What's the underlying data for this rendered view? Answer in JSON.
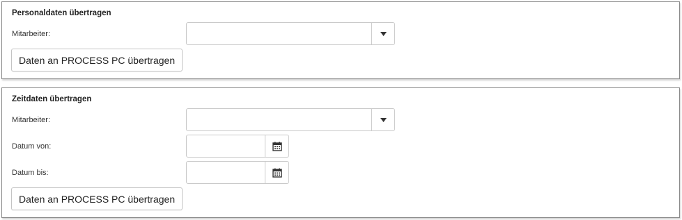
{
  "personaldaten": {
    "title": "Personaldaten übertragen",
    "mitarbeiter_label": "Mitarbeiter:",
    "mitarbeiter_value": "",
    "submit_label": "Daten an PROCESS PC übertragen"
  },
  "zeitdaten": {
    "title": "Zeitdaten übertragen",
    "mitarbeiter_label": "Mitarbeiter:",
    "mitarbeiter_value": "",
    "datum_von_label": "Datum von:",
    "datum_von_value": "",
    "datum_bis_label": "Datum bis:",
    "datum_bis_value": "",
    "submit_label": "Daten an PROCESS PC übertragen"
  },
  "icons": {
    "dropdown": "chevron-down-icon",
    "calendar": "calendar-icon"
  },
  "colors": {
    "panel_border": "#8a8a8a",
    "input_border": "#c9c9c9",
    "text": "#222222"
  }
}
